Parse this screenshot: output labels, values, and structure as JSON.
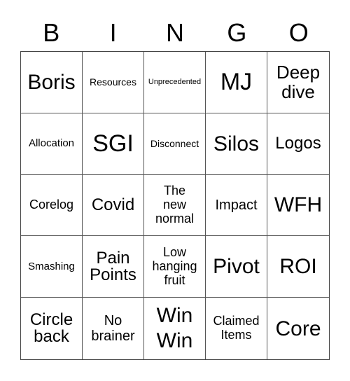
{
  "header": [
    "B",
    "I",
    "N",
    "G",
    "O"
  ],
  "cells": [
    "Boris",
    "Resources",
    "Unprecedented",
    "MJ",
    "Deep dive",
    "Allocation",
    "SGI",
    "Disconnect",
    "Silos",
    "Logos",
    "Corelog",
    "Covid",
    "The new normal",
    "Impact",
    "WFH",
    "Smashing",
    "Pain Points",
    "Low hanging fruit",
    "Pivot",
    "ROI",
    "Circle back",
    "No brainer",
    "Win Win",
    "Claimed Items",
    "Core"
  ]
}
